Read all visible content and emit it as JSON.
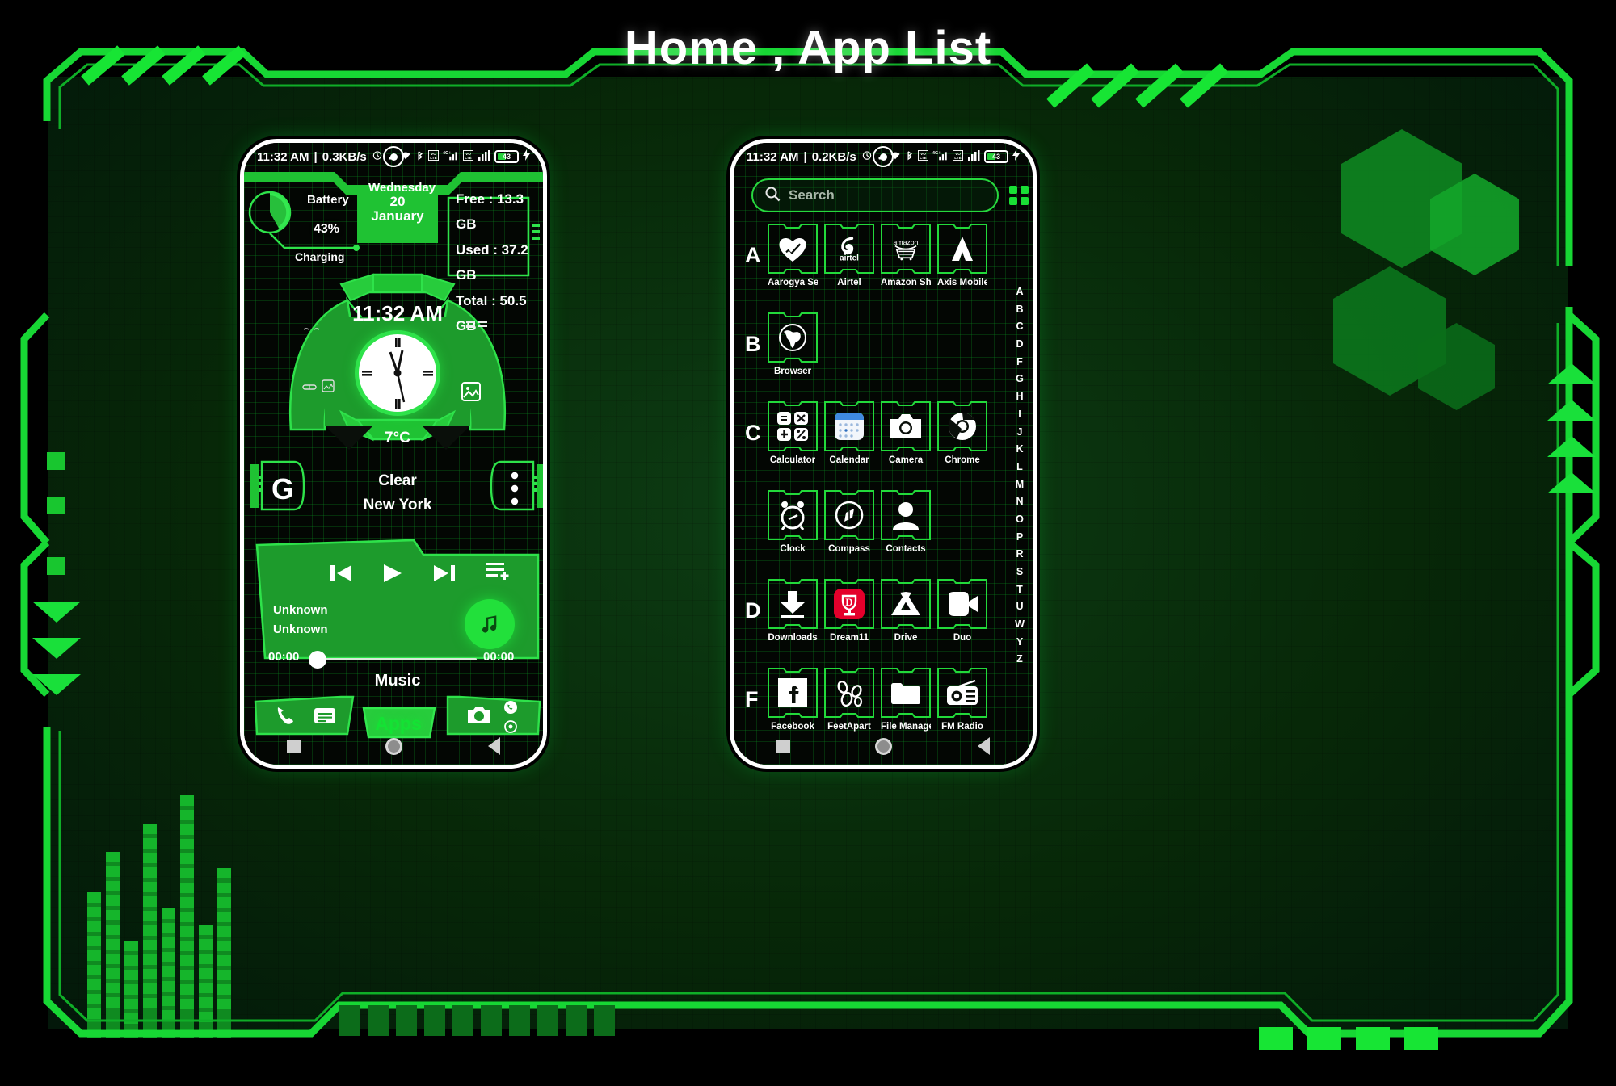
{
  "page": {
    "title": "Home , App List",
    "accent_green": "#14e234",
    "frame_green": "#17d734",
    "background": "#0a2d10"
  },
  "left_phone": {
    "name": "home-screen",
    "statusbar": {
      "time": "11:32 AM",
      "separator": "|",
      "net_speed": "0.3KB/s",
      "alarm_icon": "alarm-icon",
      "dots_icon": "more-dots-icon",
      "wifi_icon": "wifi-icon",
      "bluetooth_icon": "bluetooth-icon",
      "volte1_icon": "volte-icon",
      "network_label": "4G+",
      "signal1_icon": "signal-bars-icon",
      "volte2_icon": "volte-icon",
      "signal2_icon": "signal-bars-icon",
      "battery_percent": "43",
      "charging_icon": "charging-bolt-icon"
    },
    "battery_widget": {
      "label": "Battery",
      "percent": "43%",
      "status": "Charging"
    },
    "date_widget": {
      "weekday": "Wednesday",
      "day": "20",
      "month": "January"
    },
    "storage_widget": {
      "free": "Free : 13.3 GB",
      "used": "Used : 37.2 GB",
      "total": "Total : 50.5 GB"
    },
    "clock_widget": {
      "digital_time": "11:32 AM",
      "temperature": "7°C",
      "headphone_icons": "headphones-icon",
      "gallery_icon": "gallery-icon",
      "car_icon": "car-icon",
      "photo_icon": "photo-icon",
      "list_icon": "list-icon"
    },
    "weather": {
      "condition": "Clear",
      "city": "New York"
    },
    "google_button": {
      "label": "G"
    },
    "overflow_button": {
      "icon": "three-dots-vertical-icon"
    },
    "music_widget": {
      "title": "Unknown",
      "artist": "Unknown",
      "elapsed": "00:00",
      "duration": "00:00",
      "label": "Music",
      "prev_icon": "skip-previous-icon",
      "play_icon": "play-icon",
      "next_icon": "skip-next-icon",
      "playlist_icon": "playlist-add-icon",
      "fab_icon": "music-note-icon"
    },
    "dock": {
      "phone_icon": "phone-icon",
      "messages_icon": "messages-icon",
      "apps_label": "Apps",
      "camera_icon": "camera-icon",
      "whatsapp_icon": "whatsapp-icon",
      "settings_icon": "settings-gear-icon"
    },
    "navbar": {
      "recents_icon": "recents-square-icon",
      "home_icon": "home-circle-icon",
      "back_icon": "back-triangle-icon"
    }
  },
  "right_phone": {
    "name": "app-drawer-screen",
    "statusbar": {
      "time": "11:32 AM",
      "separator": "|",
      "net_speed": "0.2KB/s",
      "battery_percent": "43",
      "network_label": "4G+"
    },
    "search": {
      "placeholder": "Search",
      "icon": "search-icon"
    },
    "header_actions": [
      {
        "name": "grid-view-icon",
        "label": "grid-view"
      },
      {
        "name": "list-view-icon",
        "label": "list-view"
      },
      {
        "name": "refresh-icon",
        "label": "refresh"
      }
    ],
    "alpha_index": [
      "A",
      "B",
      "C",
      "D",
      "F",
      "G",
      "H",
      "I",
      "J",
      "K",
      "L",
      "M",
      "N",
      "O",
      "P",
      "R",
      "S",
      "T",
      "U",
      "W",
      "Y",
      "Z"
    ],
    "sections": [
      {
        "letter": "A",
        "apps": [
          {
            "name": "Aarogya Setu",
            "icon": "heart-check-icon"
          },
          {
            "name": "Airtel",
            "icon": "airtel-icon"
          },
          {
            "name": "Amazon Sho...",
            "icon": "amazon-cart-icon"
          },
          {
            "name": "Axis Mobile",
            "icon": "axis-bank-icon"
          }
        ]
      },
      {
        "letter": "B",
        "apps": [
          {
            "name": "Browser",
            "icon": "globe-icon"
          }
        ]
      },
      {
        "letter": "C",
        "apps": [
          {
            "name": "Calculator",
            "icon": "calculator-icon"
          },
          {
            "name": "Calendar",
            "icon": "calendar-icon"
          },
          {
            "name": "Camera",
            "icon": "camera-icon"
          },
          {
            "name": "Chrome",
            "icon": "chrome-icon"
          }
        ]
      },
      {
        "letter": "",
        "apps": [
          {
            "name": "Clock",
            "icon": "alarm-clock-icon"
          },
          {
            "name": "Compass",
            "icon": "compass-icon"
          },
          {
            "name": "Contacts",
            "icon": "contact-person-icon"
          }
        ]
      },
      {
        "letter": "D",
        "apps": [
          {
            "name": "Downloads",
            "icon": "download-arrow-icon"
          },
          {
            "name": "Dream11",
            "icon": "dream11-icon"
          },
          {
            "name": "Drive",
            "icon": "google-drive-icon"
          },
          {
            "name": "Duo",
            "icon": "video-call-icon"
          }
        ]
      },
      {
        "letter": "F",
        "apps": [
          {
            "name": "Facebook",
            "icon": "facebook-icon"
          },
          {
            "name": "FeetApart",
            "icon": "feetapart-icon"
          },
          {
            "name": "File Manager",
            "icon": "folder-icon"
          },
          {
            "name": "FM Radio",
            "icon": "radio-icon"
          }
        ]
      }
    ],
    "navbar": {
      "recents_icon": "recents-square-icon",
      "home_icon": "home-circle-icon",
      "back_icon": "back-triangle-icon"
    }
  }
}
